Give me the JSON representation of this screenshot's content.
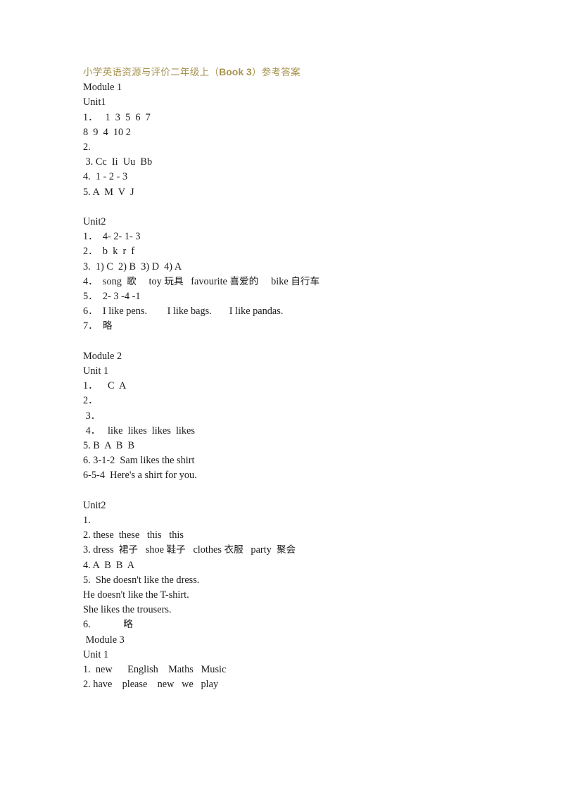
{
  "document": {
    "title_prefix": "小学英语资源与评价二年级上（",
    "title_book": "Book 3",
    "title_suffix": "）参考答案",
    "title_color": "#a8934f",
    "body_color": "#1b1b1b",
    "page_background": "#ffffff",
    "lines": [
      "Module 1",
      "Unit1",
      "1．   1  3  5  6  7",
      "8  9  4  10 2",
      "2.",
      " 3. Cc  Ii  Uu  Bb",
      "4.  1 - 2 - 3",
      "5. A  M  V  J",
      "",
      "Unit2",
      "1．  4- 2- 1- 3",
      "2．  b  k  r  f",
      "3.  1) C  2) B  3) D  4) A",
      "4．  song  歌     toy 玩具   favourite 喜爱的     bike 自行车",
      "5．  2- 3 -4 -1",
      "6．  I like pens.        I like bags.       I like pandas.",
      "7．  略",
      "",
      "Module 2",
      "Unit 1",
      "1．    C  A",
      "2．",
      " 3．",
      " 4．   like  likes  likes  likes",
      "5. B  A  B  B",
      "6. 3-1-2  Sam likes the shirt",
      "6-5-4  Here's a shirt for you.",
      "",
      "Unit2",
      "1.",
      "2. these  these   this   this",
      "3. dress  裙子   shoe 鞋子   clothes 衣服   party  聚会",
      "4. A  B  B  A",
      "5.  She doesn't like the dress.",
      "He doesn't like the T-shirt.",
      "She likes the trousers.",
      "6.             略",
      " Module 3",
      "Unit 1",
      "1.  new      English    Maths   Music",
      "2. have    please    new   we   play"
    ]
  }
}
